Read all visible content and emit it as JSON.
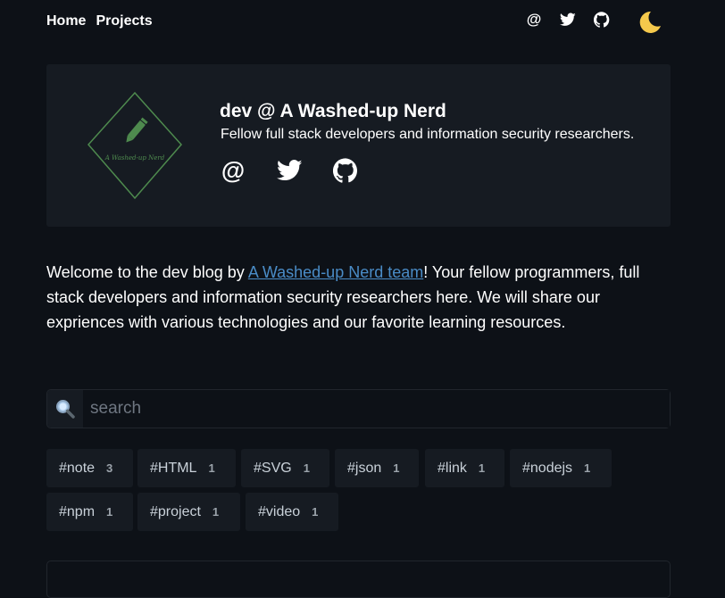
{
  "nav": {
    "links": [
      {
        "label": "Home"
      },
      {
        "label": "Projects"
      }
    ],
    "icons": [
      "at-icon",
      "twitter-icon",
      "github-icon"
    ],
    "theme_icon": "moon-icon"
  },
  "hero": {
    "logo_text": "A Washed-up Nerd",
    "title": "dev @ A Washed-up Nerd",
    "subtitle": "Fellow full stack developers and information security researchers.",
    "icons": [
      "at-icon",
      "twitter-icon",
      "github-icon"
    ]
  },
  "intro": {
    "before": "Welcome to the dev blog by ",
    "link": "A Washed-up Nerd team",
    "after": "! Your fellow programmers, full stack developers and information security researchers here. We will share our expriences with various technologies and our favorite learning resources."
  },
  "search": {
    "icon": "magnifier-icon",
    "placeholder": "search",
    "value": ""
  },
  "tags": [
    {
      "name": "#note",
      "count": "3"
    },
    {
      "name": "#HTML",
      "count": "1"
    },
    {
      "name": "#SVG",
      "count": "1"
    },
    {
      "name": "#json",
      "count": "1"
    },
    {
      "name": "#link",
      "count": "1"
    },
    {
      "name": "#nodejs",
      "count": "1"
    },
    {
      "name": "#npm",
      "count": "1"
    },
    {
      "name": "#project",
      "count": "1"
    },
    {
      "name": "#video",
      "count": "1"
    }
  ],
  "colors": {
    "background": "#0d1117",
    "panel": "#161b22",
    "link": "#4a8cc7",
    "logo_green": "#4e8a4e",
    "moon": "#f5c94c"
  }
}
